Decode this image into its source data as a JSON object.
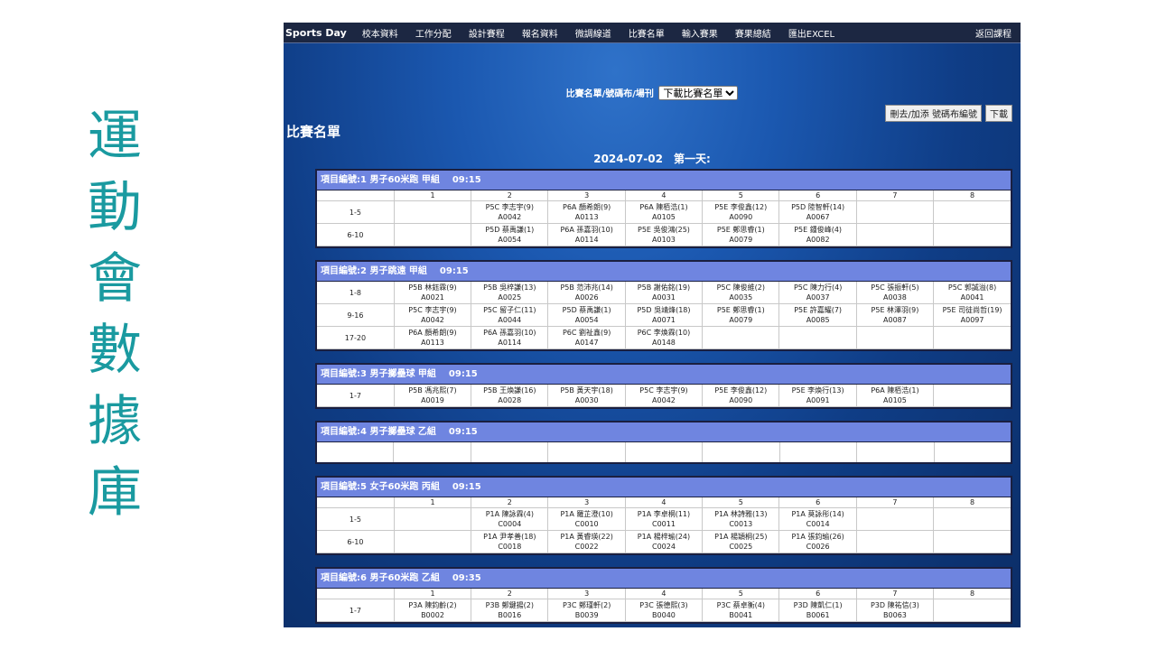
{
  "side_title": [
    "運",
    "動",
    "會",
    "數",
    "據",
    "庫"
  ],
  "nav": {
    "brand": "Sports Day",
    "items": [
      "校本資料",
      "工作分配",
      "設計賽程",
      "報名資料",
      "微調線道",
      "比賽名單",
      "輸入賽果",
      "賽果總結",
      "匯出EXCEL"
    ],
    "right": "返回課程"
  },
  "selector": {
    "label": "比賽名單/號碼布/場刊",
    "selected": "下載比賽名單"
  },
  "buttons": {
    "renumber": "刪去/加添 號碼布編號",
    "download": "下載"
  },
  "page_title": "比賽名單",
  "date_heading": "2024-07-02　第一天:",
  "events": [
    {
      "title": "項目編號:1 男子60米跑 甲組",
      "time": "09:15",
      "header_row": true,
      "rows": [
        {
          "label": "1-5",
          "cells": [
            [
              "",
              ""
            ],
            [
              "P5C 李志宇(9)",
              "A0042"
            ],
            [
              "P6A 顏希朗(9)",
              "A0113"
            ],
            [
              "P6A 陳栢浩(1)",
              "A0105"
            ],
            [
              "P5E 李俊鑫(12)",
              "A0090"
            ],
            [
              "P5D 陸智軒(14)",
              "A0067"
            ],
            [
              "",
              ""
            ],
            [
              "",
              ""
            ]
          ]
        },
        {
          "label": "6-10",
          "cells": [
            [
              "",
              ""
            ],
            [
              "P5D 蔡禹謙(1)",
              "A0054"
            ],
            [
              "P6A 孫嘉羽(10)",
              "A0114"
            ],
            [
              "P5E 吳俊鴻(25)",
              "A0103"
            ],
            [
              "P5E 鄭思睿(1)",
              "A0079"
            ],
            [
              "P5E 鍾俊峰(4)",
              "A0082"
            ],
            [
              "",
              ""
            ],
            [
              "",
              ""
            ]
          ]
        }
      ]
    },
    {
      "title": "項目編號:2 男子跳遠 甲組",
      "time": "09:15",
      "header_row": false,
      "rows": [
        {
          "label": "1-8",
          "cells": [
            [
              "P5B 林鈺霖(9)",
              "A0021"
            ],
            [
              "P5B 吳梓謙(13)",
              "A0025"
            ],
            [
              "P5B 范沛兆(14)",
              "A0026"
            ],
            [
              "P5B 謝佑銘(19)",
              "A0031"
            ],
            [
              "P5C 陳俊維(2)",
              "A0035"
            ],
            [
              "P5C 陳力行(4)",
              "A0037"
            ],
            [
              "P5C 張振軒(5)",
              "A0038"
            ],
            [
              "P5C 郭誠溢(8)",
              "A0041"
            ]
          ]
        },
        {
          "label": "9-16",
          "cells": [
            [
              "P5C 李志宇(9)",
              "A0042"
            ],
            [
              "P5C 留子仁(11)",
              "A0044"
            ],
            [
              "P5D 蔡禹謙(1)",
              "A0054"
            ],
            [
              "P5D 吳靖烽(18)",
              "A0071"
            ],
            [
              "P5E 鄭思睿(1)",
              "A0079"
            ],
            [
              "P5E 許嘉耀(7)",
              "A0085"
            ],
            [
              "P5E 林澤羽(9)",
              "A0087"
            ],
            [
              "P5E 司徒尚哲(19)",
              "A0097"
            ]
          ]
        },
        {
          "label": "17-20",
          "cells": [
            [
              "P6A 顏希朗(9)",
              "A0113"
            ],
            [
              "P6A 孫嘉羽(10)",
              "A0114"
            ],
            [
              "P6C 劉祉鑫(9)",
              "A0147"
            ],
            [
              "P6C 李煥霖(10)",
              "A0148"
            ],
            [
              "",
              ""
            ],
            [
              "",
              ""
            ],
            [
              "",
              ""
            ],
            [
              "",
              ""
            ]
          ]
        }
      ]
    },
    {
      "title": "項目編號:3 男子擲壘球 甲組",
      "time": "09:15",
      "header_row": false,
      "rows": [
        {
          "label": "1-7",
          "cells": [
            [
              "P5B 馮兆熙(7)",
              "A0019"
            ],
            [
              "P5B 王煥謙(16)",
              "A0028"
            ],
            [
              "P5B 黃天宇(18)",
              "A0030"
            ],
            [
              "P5C 李志宇(9)",
              "A0042"
            ],
            [
              "P5E 李俊鑫(12)",
              "A0090"
            ],
            [
              "P5E 李煥行(13)",
              "A0091"
            ],
            [
              "P6A 陳栢浩(1)",
              "A0105"
            ],
            [
              "",
              ""
            ]
          ]
        }
      ]
    },
    {
      "title": "項目編號:4 男子擲壘球 乙組",
      "time": "09:15",
      "header_row": false,
      "empty": true,
      "rows": []
    },
    {
      "title": "項目編號:5 女子60米跑 丙組",
      "time": "09:15",
      "header_row": true,
      "rows": [
        {
          "label": "1-5",
          "cells": [
            [
              "",
              ""
            ],
            [
              "P1A 陳詠霖(4)",
              "C0004"
            ],
            [
              "P1A 羅芷澄(10)",
              "C0010"
            ],
            [
              "P1A 李卓桐(11)",
              "C0011"
            ],
            [
              "P1A 林詩雅(13)",
              "C0013"
            ],
            [
              "P1A 莫詠彤(14)",
              "C0014"
            ],
            [
              "",
              ""
            ],
            [
              "",
              ""
            ]
          ]
        },
        {
          "label": "6-10",
          "cells": [
            [
              "",
              ""
            ],
            [
              "P1A 尹孝善(18)",
              "C0018"
            ],
            [
              "P1A 黃睿瑛(22)",
              "C0022"
            ],
            [
              "P1A 楊梓瑜(24)",
              "C0024"
            ],
            [
              "P1A 楊穎桐(25)",
              "C0025"
            ],
            [
              "P1A 張鈞瑜(26)",
              "C0026"
            ],
            [
              "",
              ""
            ],
            [
              "",
              ""
            ]
          ]
        }
      ]
    },
    {
      "title": "項目編號:6 男子60米跑 乙組",
      "time": "09:35",
      "header_row": true,
      "rows": [
        {
          "label": "1-7",
          "cells": [
            [
              "P3A 陳鈞齡(2)",
              "B0002"
            ],
            [
              "P3B 鄭鍵揚(2)",
              "B0016"
            ],
            [
              "P3C 鄭瑾軒(2)",
              "B0039"
            ],
            [
              "P3C 張德熙(3)",
              "B0040"
            ],
            [
              "P3C 蔡卓衡(4)",
              "B0041"
            ],
            [
              "P3D 陳凱仁(1)",
              "B0061"
            ],
            [
              "P3D 陳祐信(3)",
              "B0063"
            ],
            [
              "",
              ""
            ]
          ]
        }
      ]
    }
  ],
  "column_numbers": [
    "1",
    "2",
    "3",
    "4",
    "5",
    "6",
    "7",
    "8"
  ]
}
